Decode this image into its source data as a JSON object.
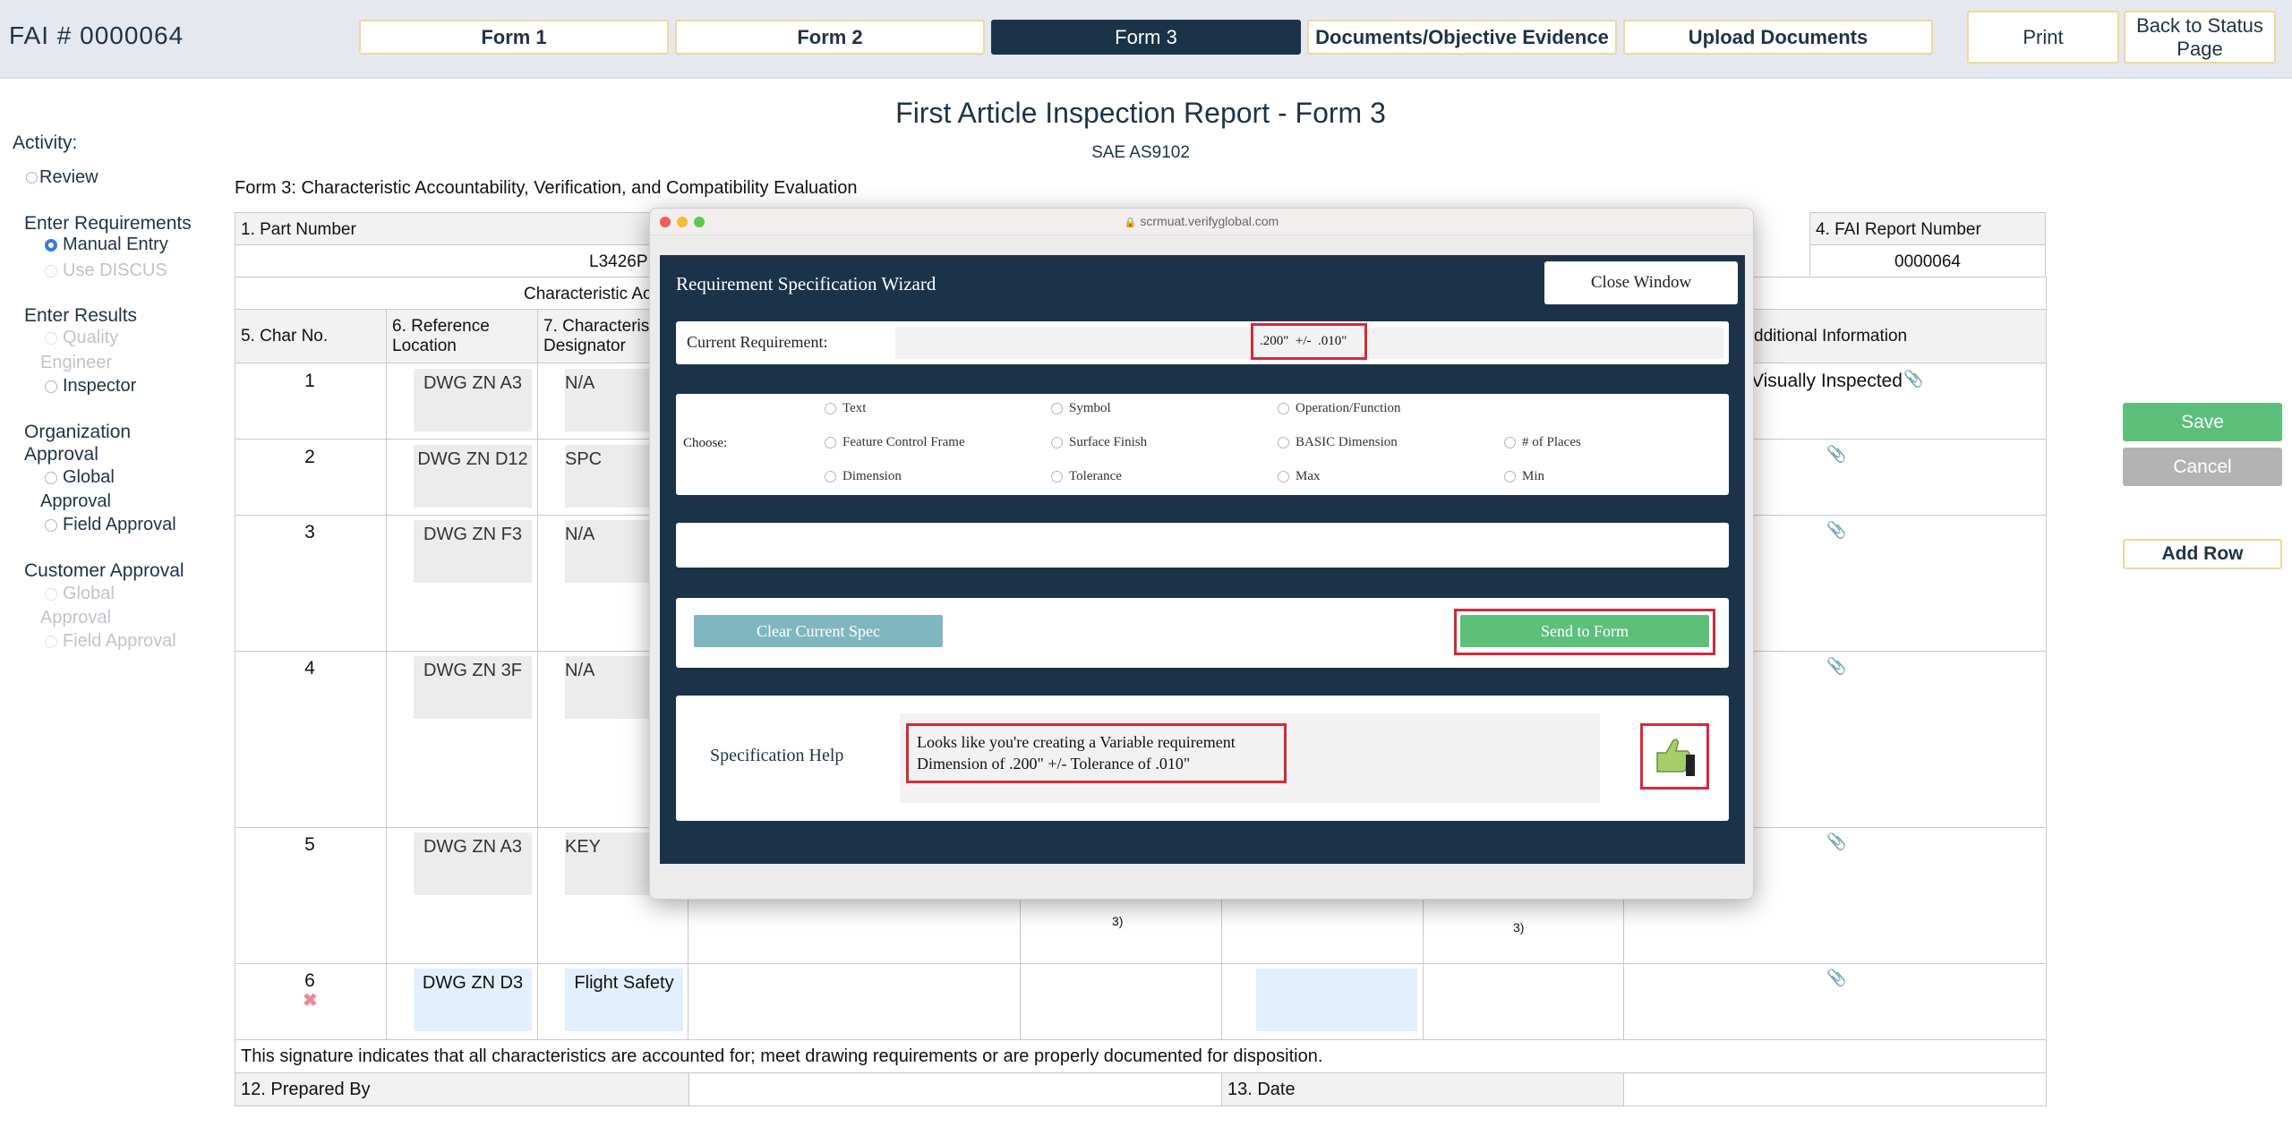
{
  "topbar": {
    "fai_title": "FAI # 0000064",
    "tabs": [
      "Form 1",
      "Form 2",
      "Form 3",
      "Documents/Objective Evidence",
      "Upload Documents"
    ],
    "print_label": "Print",
    "back_label": "Back to Status Page"
  },
  "left_panel": {
    "activity_label": "Activity:",
    "review_label": "Review",
    "enter_requirements_label": "Enter Requirements",
    "manual_entry_label": "Manual Entry",
    "use_discus_label": "Use DISCUS",
    "enter_results_label": "Enter Results",
    "quality_engineer_label_1": "Quality",
    "quality_engineer_label_2": "Engineer",
    "inspector_label": "Inspector",
    "org_approval_label_1": "Organization",
    "org_approval_label_2": "Approval",
    "global_approval_label_1": "Global",
    "global_approval_label_2": "Approval",
    "field_approval_label": "Field Approval",
    "customer_approval_label": "Customer Approval",
    "cust_global_approval_label_1": "Global",
    "cust_global_approval_label_2": "Approval",
    "cust_field_approval_label": "Field Approval"
  },
  "report": {
    "title": "First Article Inspection Report - Form 3",
    "subtitle": "SAE AS9102",
    "caption": "Form 3: Characteristic Accountability, Verification, and Compatibility Evaluation",
    "part_number_label": "1. Part Number",
    "part_number_value": "L3426P",
    "char_acc_label": "Characteristic Ac",
    "fai_report_number_label": "4. FAI Report Number",
    "fai_report_number_value": "0000064",
    "col_char_no": "5. Char No.",
    "col_ref_location": "6. Reference Location",
    "col_char_designator": "7. Characterist Designator",
    "col_additional_info": "dditional Information",
    "rows": [
      {
        "no": "1",
        "ref": "DWG ZN A3",
        "des": "N/A",
        "info": "Visually Inspected"
      },
      {
        "no": "2",
        "ref": "DWG ZN D12",
        "des": "SPC",
        "info": ""
      },
      {
        "no": "3",
        "ref": "DWG ZN F3",
        "des": "N/A",
        "info": ""
      },
      {
        "no": "4",
        "ref": "DWG ZN 3F",
        "des": "N/A",
        "info": ""
      },
      {
        "no": "5",
        "ref": "DWG ZN A3",
        "des": "KEY",
        "info": ""
      },
      {
        "no": "6",
        "ref": "DWG ZN D3",
        "des": "Flight Safety",
        "info": ""
      }
    ],
    "row5_note_a": "3)",
    "row5_note_b": "3)",
    "signature_text": "This signature indicates that all characteristics are accounted for; meet drawing requirements or are properly documented for disposition.",
    "prepared_by_label": "12. Prepared By",
    "date_label": "13. Date"
  },
  "right_buttons": {
    "save": "Save",
    "cancel": "Cancel",
    "add_row": "Add Row"
  },
  "modal": {
    "url": "scrmuat.verifyglobal.com",
    "title": "Requirement Specification Wizard",
    "close_label": "Close Window",
    "current_req_label": "Current Requirement:",
    "current_req_value": ".200\"  +/-  .010\"",
    "choose_label": "Choose:",
    "options_row1": [
      "Text",
      "Symbol",
      "Operation/Function"
    ],
    "options_row2": [
      "Feature Control Frame",
      "Surface Finish",
      "BASIC Dimension",
      "# of Places"
    ],
    "options_row3": [
      "Dimension",
      "Tolerance",
      "Max",
      "Min"
    ],
    "clear_label": "Clear Current Spec",
    "send_label": "Send to Form",
    "help_label": "Specification Help",
    "help_line1": "Looks like you're creating a Variable requirement",
    "help_line2": "Dimension of .200\" +/- Tolerance of .010\""
  },
  "colors": {
    "navy": "#1b3349",
    "accent_gold": "#f0d89a",
    "save_green": "#5cc07a",
    "cancel_gray": "#b3b3b3",
    "highlight_red": "#d42a3a"
  }
}
